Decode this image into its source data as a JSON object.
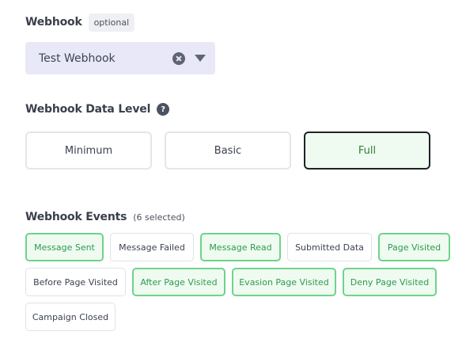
{
  "webhook": {
    "label": "Webhook",
    "optional_badge": "optional",
    "selected_value": "Test Webhook"
  },
  "data_level": {
    "label": "Webhook Data Level",
    "help_glyph": "?",
    "options": [
      "Minimum",
      "Basic",
      "Full"
    ],
    "selected": "Full"
  },
  "events": {
    "label": "Webhook Events",
    "selected_count": "(6 selected)",
    "items": [
      {
        "label": "Message Sent",
        "selected": true
      },
      {
        "label": "Message Failed",
        "selected": false
      },
      {
        "label": "Message Read",
        "selected": true
      },
      {
        "label": "Submitted Data",
        "selected": false
      },
      {
        "label": "Page Visited",
        "selected": true
      },
      {
        "label": "Before Page Visited",
        "selected": false
      },
      {
        "label": "After Page Visited",
        "selected": true
      },
      {
        "label": "Evasion Page Visited",
        "selected": true
      },
      {
        "label": "Deny Page Visited",
        "selected": true
      },
      {
        "label": "Campaign Closed",
        "selected": false
      }
    ]
  },
  "colors": {
    "accent_green": "#6ed48a",
    "selected_bg": "#effbf1",
    "select_bg": "#e8e8f8"
  }
}
